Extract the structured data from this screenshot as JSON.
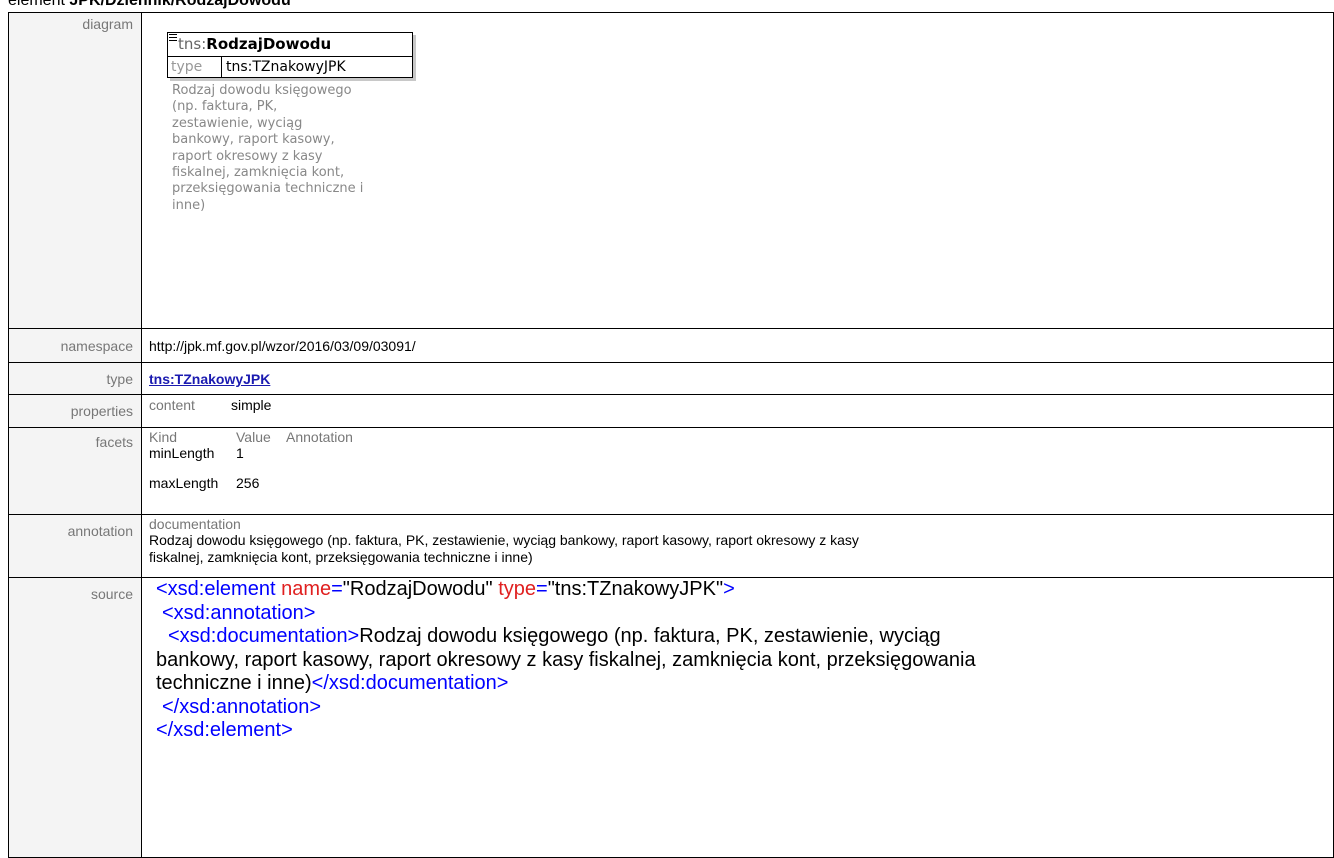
{
  "page_title_prefix": "element ",
  "page_title_name": "JPK/Dziennik/RodzajDowodu",
  "labels": {
    "diagram": "diagram",
    "namespace": "namespace",
    "type": "type",
    "properties": "properties",
    "facets": "facets",
    "annotation": "annotation",
    "source": "source"
  },
  "diagram": {
    "ns_prefix": "tns:",
    "element_name": "RodzajDowodu",
    "type_key": "type",
    "type_value": "tns:TZnakowyJPK",
    "description_lines": [
      "Rodzaj dowodu księgowego",
      "(np. faktura, PK,",
      "zestawienie, wyciąg",
      "bankowy, raport kasowy,",
      "raport okresowy z kasy",
      "fiskalnej, zamknięcia kont,",
      "przeksięgowania techniczne i",
      "inne)"
    ]
  },
  "namespace": "http://jpk.mf.gov.pl/wzor/2016/03/09/03091/",
  "type_link": "tns:TZnakowyJPK",
  "properties": {
    "key": "content",
    "value": "simple"
  },
  "facets": {
    "headers": [
      "Kind",
      "Value",
      "Annotation"
    ],
    "rows": [
      {
        "kind": "minLength",
        "value": "1"
      },
      {
        "kind": "maxLength",
        "value": "256"
      }
    ]
  },
  "annotation": {
    "key": "documentation",
    "line1": "Rodzaj dowodu księgowego (np. faktura, PK, zestawienie, wyciąg bankowy, raport kasowy, raport okresowy z kasy",
    "line2": "fiskalnej, zamknięcia kont, przeksięgowania techniczne i inne)"
  },
  "source": {
    "el_open": "<xsd:element",
    "attr_name": "name",
    "attr_name_val": "\"RodzajDowodu\"",
    "attr_type": "type",
    "attr_type_val": "\"tns:TZnakowyJPK\"",
    "close_gt": ">",
    "eq": "=",
    "ann_open": "<xsd:annotation>",
    "doc_open": "<xsd:documentation>",
    "doc_text_1": "Rodzaj dowodu księgowego (np. faktura, PK, zestawienie, wyciąg",
    "doc_text_2": "bankowy, raport kasowy, raport okresowy z kasy fiskalnej, zamknięcia kont, przeksięgowania",
    "doc_text_3": "techniczne i inne)",
    "doc_close": "</xsd:documentation>",
    "ann_close": "</xsd:annotation>",
    "el_close": "</xsd:element>"
  }
}
